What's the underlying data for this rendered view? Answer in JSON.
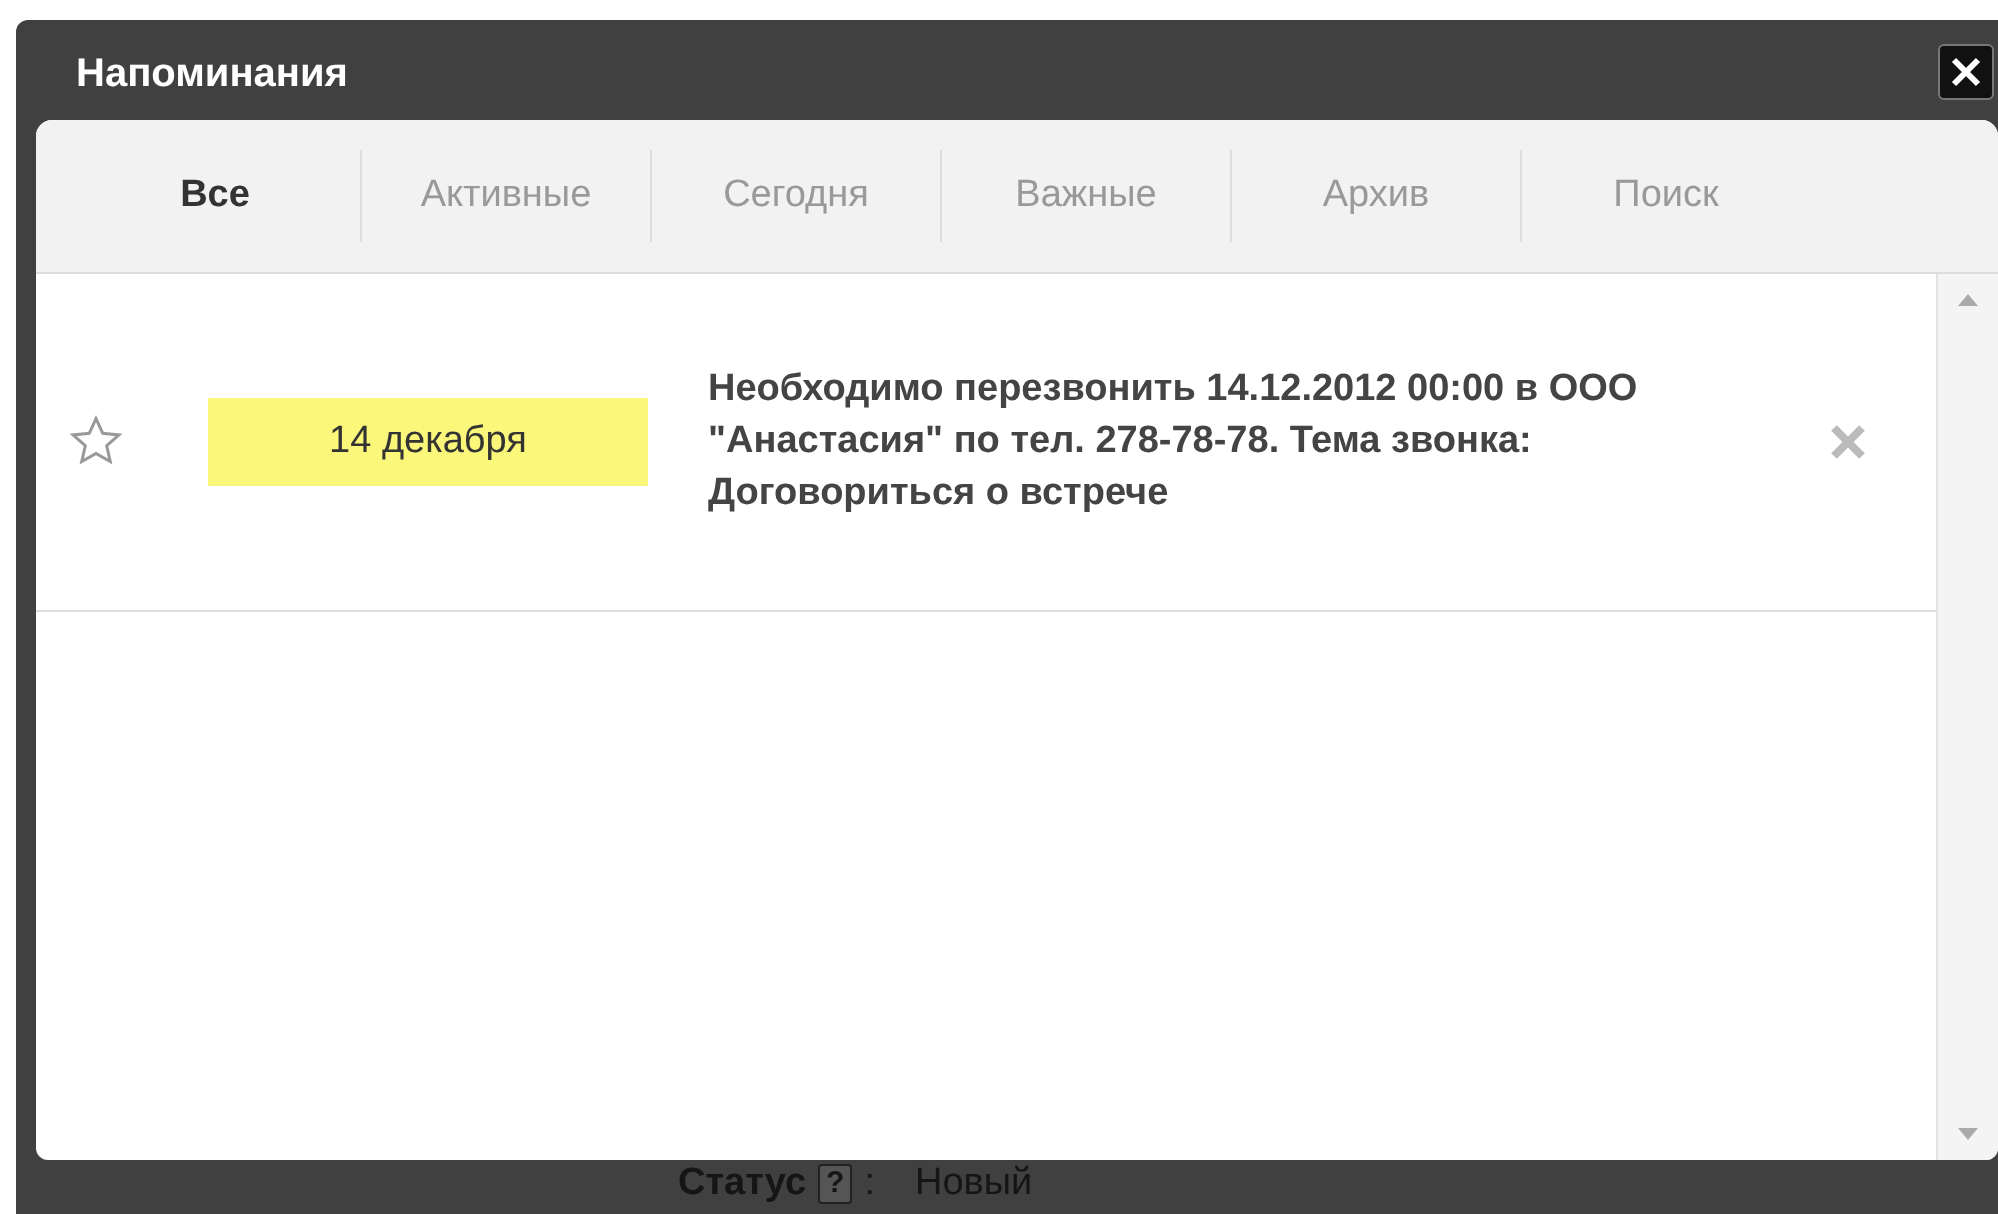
{
  "window": {
    "title": "Напоминания"
  },
  "tabs": [
    {
      "label": "Все",
      "selected": true
    },
    {
      "label": "Активные",
      "selected": false
    },
    {
      "label": "Сегодня",
      "selected": false
    },
    {
      "label": "Важные",
      "selected": false
    },
    {
      "label": "Архив",
      "selected": false
    },
    {
      "label": "Поиск",
      "selected": false
    }
  ],
  "reminders": [
    {
      "starred": false,
      "date": "14 декабря",
      "text": "Необходимо перезвонить 14.12.2012 00:00 в ООО \"Анастасия\" по тел. 278-78-78. Тема звонка: Договориться о встрече"
    }
  ],
  "background_form": {
    "label": "Статус",
    "help": "?",
    "separator": ":",
    "value": "Новый"
  }
}
